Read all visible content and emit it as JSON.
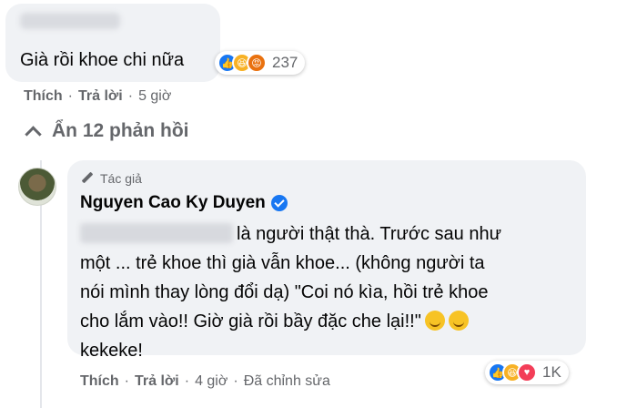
{
  "comment1": {
    "text": "Già rồi khoe chi nữa",
    "reactions": {
      "icons": [
        "like-icon",
        "haha-icon",
        "angry-icon"
      ],
      "count": "237"
    },
    "meta": {
      "like": "Thích",
      "reply": "Trả lời",
      "time": "5 giờ"
    }
  },
  "replies_toggle": {
    "label": "Ẩn 12 phản hồi"
  },
  "comment2": {
    "badge": "Tác giả",
    "author": "Nguyen Cao Ky Duyen",
    "lines": [
      "là người thật thà. Trước sau như",
      "một ... trẻ khoe thì già vẫn khoe... (không người ta",
      "nói mình thay lòng đổi dạ) \"Coi nó kìa, hồi trẻ khoe",
      "cho lắm vào!! Giờ già rồi bầy đặc che lại!!\"",
      "kekeke!"
    ],
    "emojis": [
      "tongue-face-emoji",
      "smirk-face-emoji"
    ],
    "reactions": {
      "icons": [
        "like-icon",
        "haha-icon",
        "love-icon"
      ],
      "count": "1K"
    },
    "meta": {
      "like": "Thích",
      "reply": "Trả lời",
      "time": "4 giờ",
      "edited": "Đã chỉnh sửa"
    }
  },
  "colors": {
    "bubble": "#f0f2f5",
    "meta_text": "#65676b",
    "verified": "#1877f2"
  }
}
